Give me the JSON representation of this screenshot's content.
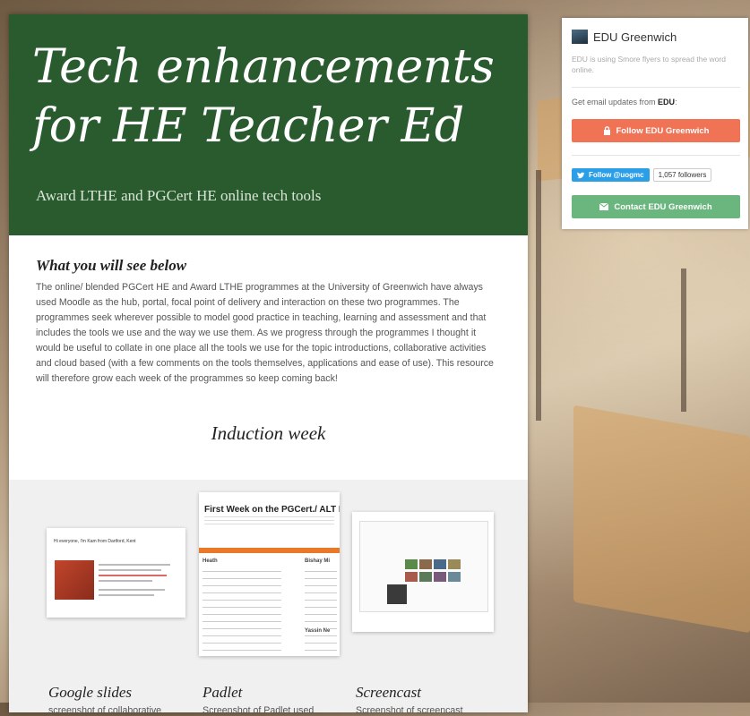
{
  "colors": {
    "hero_bg": "#2a5b2f",
    "follow_button": "#f07356",
    "contact_button": "#6ab67e",
    "twitter_button": "#2a9ee6"
  },
  "hero": {
    "title": "Tech enhancements for HE Teacher Ed",
    "subtitle": "Award LTHE and PGCert HE online tech tools"
  },
  "intro": {
    "heading": "What you will see below",
    "body": "The online/ blended PGCert HE and Award LTHE programmes at the University of Greenwich have always used Moodle as the hub, portal, focal point of delivery and interaction on these two programmes. The programmes seek wherever possible to model good practice in teaching, learning and assessment and that includes the tools we use and the way we use them. As we progress through the programmes I thought it would be useful to collate in one place all the tools we use for the topic introductions, collaborative activities and cloud based (with a few comments on the tools themselves, applications and ease of use). This resource will therefore grow each week of the programmes so keep coming back!"
  },
  "section": {
    "title": "Induction week"
  },
  "gallery": {
    "items": [
      {
        "label": "Google slides",
        "desc": "screenshot of collaborative",
        "thumb_text": "Hi everyone, I'm Kam from Dartford, Kent"
      },
      {
        "label": "Padlet",
        "desc": "Screenshot of Padlet used",
        "thumb_title": "First Week on the PGCert./ ALT H",
        "col1": "Heath",
        "col2": "Bishay Mi",
        "col3": "Yassin Ne"
      },
      {
        "label": "Screencast",
        "desc": "Screenshot of screencast"
      }
    ]
  },
  "sidebar": {
    "org_name": "EDU Greenwich",
    "org_desc": "EDU is using Smore flyers to spread the word online.",
    "email_prefix": "Get email updates from ",
    "email_org": "EDU",
    "email_suffix": ":",
    "follow_button": "Follow EDU Greenwich",
    "twitter_button": "Follow @uogmc",
    "twitter_followers": "1,057 followers",
    "contact_button": "Contact EDU Greenwich",
    "icons": [
      "lock-icon",
      "twitter-bird-icon",
      "envelope-icon"
    ]
  }
}
